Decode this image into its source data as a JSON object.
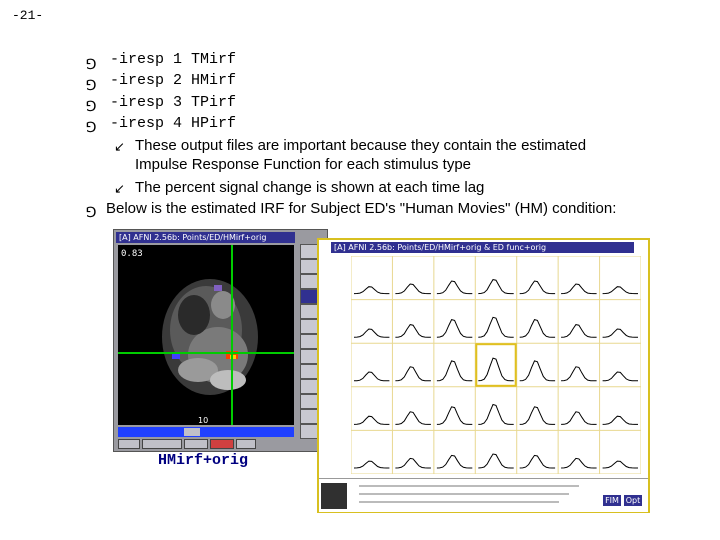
{
  "page": {
    "number": "-21-"
  },
  "bullets": [
    {
      "text": "-iresp 1 TMirf"
    },
    {
      "text": "-iresp 2 HMirf"
    },
    {
      "text": "-iresp 3 TPirf"
    },
    {
      "text": "-iresp 4 HPirf"
    }
  ],
  "sub_bullets": [
    {
      "line1": "These output files are important because they contain the estimated",
      "line2": "Impulse Response Function for each stimulus type"
    },
    {
      "line1": "The percent signal change is shown at each time lag",
      "line2": ""
    }
  ],
  "final_bullet": "Below is the estimated IRF for Subject ED's \"Human Movies\" (HM) condition:",
  "icons": {
    "bullet": "bullet-icon",
    "sub_bullet": "arrow-bullet-icon"
  },
  "screenshot_left": {
    "title": "[A] AFNI 2.56b: Points/ED/HMirf+orig",
    "slider_value": "10",
    "crosshair_color": "#00cc00",
    "caption": "HMirf+orig"
  },
  "screenshot_right": {
    "title": "[A] AFNI 2.56b: Points/ED/HMirf+orig & ED func+orig",
    "highlight_color": "#e0c020",
    "grid_rows": 5,
    "grid_cols": 7,
    "buttons": {
      "fim": "FIM",
      "opt": "Opt"
    }
  }
}
